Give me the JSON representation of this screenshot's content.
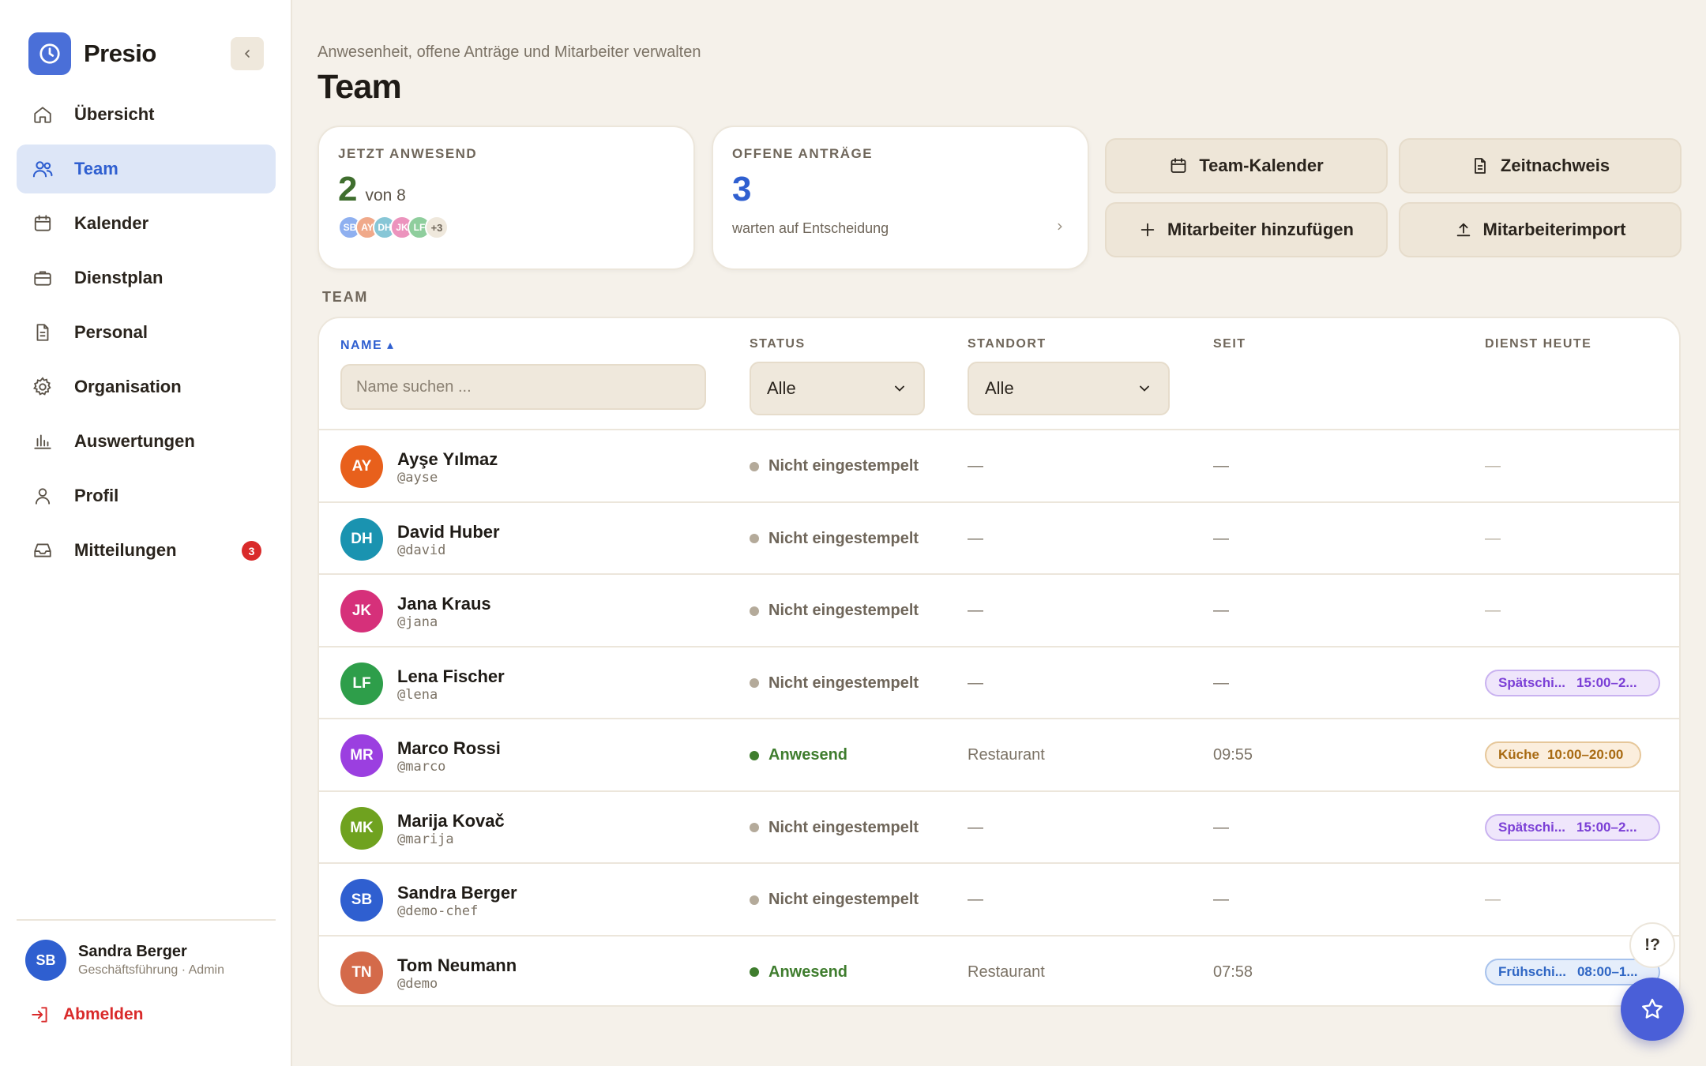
{
  "app": {
    "name": "Presio"
  },
  "sidebar": {
    "items": [
      {
        "label": "Übersicht",
        "icon": "home-icon"
      },
      {
        "label": "Team",
        "icon": "users-icon",
        "active": true
      },
      {
        "label": "Kalender",
        "icon": "calendar-icon"
      },
      {
        "label": "Dienstplan",
        "icon": "briefcase-icon"
      },
      {
        "label": "Personal",
        "icon": "document-icon"
      },
      {
        "label": "Organisation",
        "icon": "gear-icon"
      },
      {
        "label": "Auswertungen",
        "icon": "bar-chart-icon"
      },
      {
        "label": "Profil",
        "icon": "user-icon"
      },
      {
        "label": "Mitteilungen",
        "icon": "inbox-icon",
        "badge": "3"
      }
    ],
    "user": {
      "initials": "SB",
      "name": "Sandra Berger",
      "role": "Geschäftsführung · Admin"
    },
    "logout_label": "Abmelden"
  },
  "header": {
    "subtitle": "Anwesenheit, offene Anträge und Mitarbeiter verwalten",
    "title": "Team"
  },
  "stats": {
    "present": {
      "label": "JETZT ANWESEND",
      "count": "2",
      "suffix": "von 8",
      "avatars": [
        "SB",
        "AY",
        "DH",
        "JK",
        "LF"
      ],
      "more": "+3"
    },
    "requests": {
      "label": "OFFENE ANTRÄGE",
      "count": "3",
      "sub": "warten auf Entscheidung"
    }
  },
  "actions": {
    "calendar": "Team-Kalender",
    "timesheet": "Zeitnachweis",
    "add_employee": "Mitarbeiter hinzufügen",
    "import": "Mitarbeiterimport"
  },
  "section_label": "TEAM",
  "table": {
    "columns": {
      "name": "NAME ▴",
      "status": "STATUS",
      "location": "STANDORT",
      "since": "SEIT",
      "shift": "DIENST HEUTE"
    },
    "search_placeholder": "Name suchen ...",
    "status_filter": "Alle",
    "location_filter": "Alle",
    "rows": [
      {
        "initials": "AY",
        "name": "Ayşe Yılmaz",
        "handle": "@ayse",
        "status": "Nicht eingestempelt",
        "location": "—",
        "since": "—",
        "shift": "—"
      },
      {
        "initials": "DH",
        "name": "David Huber",
        "handle": "@david",
        "status": "Nicht eingestempelt",
        "location": "—",
        "since": "—",
        "shift": "—"
      },
      {
        "initials": "JK",
        "name": "Jana Kraus",
        "handle": "@jana",
        "status": "Nicht eingestempelt",
        "location": "—",
        "since": "—",
        "shift": "—"
      },
      {
        "initials": "LF",
        "name": "Lena Fischer",
        "handle": "@lena",
        "status": "Nicht eingestempelt",
        "location": "—",
        "since": "—",
        "shift_name": "Spätschi...",
        "shift_time": "15:00–2..."
      },
      {
        "initials": "MR",
        "name": "Marco Rossi",
        "handle": "@marco",
        "status": "Anwesend",
        "location": "Restaurant",
        "since": "09:55",
        "shift_name": "Küche",
        "shift_time": "10:00–20:00"
      },
      {
        "initials": "MK",
        "name": "Marija Kovač",
        "handle": "@marija",
        "status": "Nicht eingestempelt",
        "location": "—",
        "since": "—",
        "shift_name": "Spätschi...",
        "shift_time": "15:00–2..."
      },
      {
        "initials": "SB",
        "name": "Sandra Berger",
        "handle": "@demo-chef",
        "status": "Nicht eingestempelt",
        "location": "—",
        "since": "—",
        "shift": "—"
      },
      {
        "initials": "TN",
        "name": "Tom Neumann",
        "handle": "@demo",
        "status": "Anwesend",
        "location": "Restaurant",
        "since": "07:58",
        "shift_name": "Frühschi...",
        "shift_time": "08:00–1..."
      }
    ]
  },
  "help_label": "!?",
  "colors": {
    "accent": "#2f5fd0",
    "present": "#3f7d2e",
    "badge": "#d92a2a",
    "avatar_AY": "#e8601c",
    "avatar_DH": "#1a93b0",
    "avatar_JK": "#d6307a",
    "avatar_LF": "#2e9e4a",
    "avatar_MR": "#9b3fe0",
    "avatar_MK": "#6fa21f",
    "avatar_SB": "#2f5fd0",
    "avatar_TN": "#d46a4a"
  }
}
